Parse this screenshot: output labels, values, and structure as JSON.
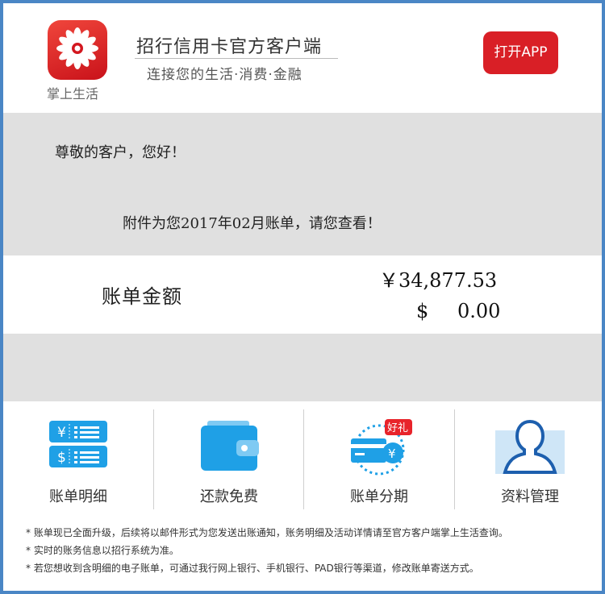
{
  "header": {
    "logo_icon": "zhangshang-shenghuo-flower-logo",
    "logo_caption": "掌上生活",
    "app_title": "招行信用卡官方客户端",
    "app_subtitle": "连接您的生活·消费·金融",
    "open_button": "打开APP",
    "accent_color": "#d91f26"
  },
  "message": {
    "greeting": "尊敬的客户，您好！",
    "notice": "附件为您2017年02月账单，请您查看！"
  },
  "bill": {
    "label": "账单金额",
    "amount_cny": "￥34,877.53",
    "usd_symbol": "$",
    "amount_usd": "0.00"
  },
  "quick_links": [
    {
      "label": "账单明细",
      "icon": "bill-details-icon"
    },
    {
      "label": "还款免费",
      "icon": "wallet-icon"
    },
    {
      "label": "账单分期",
      "icon": "installment-icon",
      "badge": "好礼",
      "coin": "¥"
    },
    {
      "label": "资料管理",
      "icon": "profile-icon"
    }
  ],
  "bill_icon_glyphs": {
    "yen": "¥",
    "dollar": "$"
  },
  "footnotes": [
    "* 账单现已全面升级，后续将以邮件形式为您发送出账通知，账务明细及活动详情请至官方客户端掌上生活查询。",
    "* 实时的账务信息以招行系统为准。",
    "* 若您想收到含明细的电子账单，可通过我行网上银行、手机银行、PAD银行等渠道，修改账单寄送方式。"
  ],
  "colors": {
    "frame": "#4a86c5",
    "icon_blue": "#1fa0e6",
    "grey_band": "#e0e0e0"
  }
}
